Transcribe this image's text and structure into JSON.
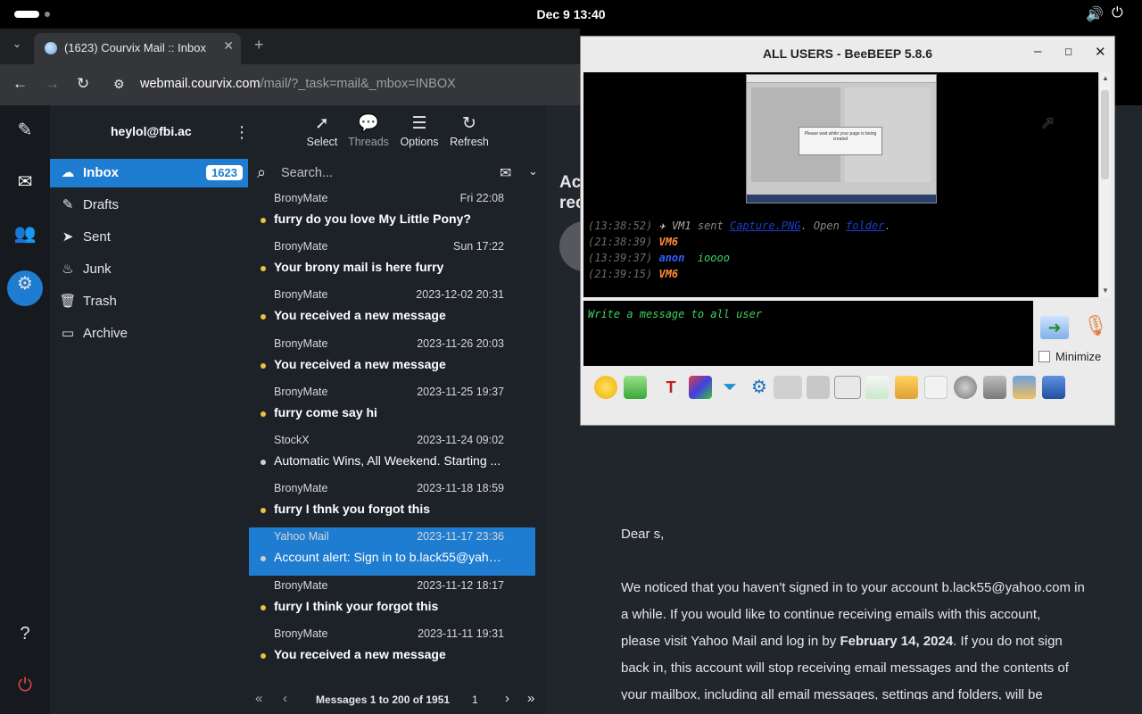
{
  "topbar": {
    "clock": "Dec 9  13:40"
  },
  "browser": {
    "tab_title": "(1623) Courvix Mail :: Inbox",
    "url_domain": "webmail.courvix.com",
    "url_path": "/mail/?_task=mail&_mbox=INBOX"
  },
  "account": "heylol@fbi.ac",
  "toolbar": {
    "select": "Select",
    "threads": "Threads",
    "options": "Options",
    "refresh": "Refresh"
  },
  "search_placeholder": "Search...",
  "folders": [
    {
      "label": "Inbox",
      "icon": "inbox-icon",
      "count": "1623"
    },
    {
      "label": "Drafts",
      "icon": "pencil-icon"
    },
    {
      "label": "Sent",
      "icon": "paper-plane-icon"
    },
    {
      "label": "Junk",
      "icon": "fire-icon"
    },
    {
      "label": "Trash",
      "icon": "trash-icon"
    },
    {
      "label": "Archive",
      "icon": "folder-icon"
    }
  ],
  "messages": [
    {
      "from": "BronyMate",
      "date": "Fri 22:08",
      "subject": "furry do you love My Little Pony?",
      "unread": true
    },
    {
      "from": "BronyMate",
      "date": "Sun 17:22",
      "subject": "Your brony mail is here furry",
      "unread": true
    },
    {
      "from": "BronyMate",
      "date": "2023-12-02 20:31",
      "subject": "You received a new message",
      "unread": true
    },
    {
      "from": "BronyMate",
      "date": "2023-11-26 20:03",
      "subject": "You received a new message",
      "unread": true
    },
    {
      "from": "BronyMate",
      "date": "2023-11-25 19:37",
      "subject": "furry come say hi",
      "unread": true
    },
    {
      "from": "StockX",
      "date": "2023-11-24 09:02",
      "subject": "Automatic Wins, All Weekend. Starting ...",
      "unread": false
    },
    {
      "from": "BronyMate",
      "date": "2023-11-18 18:59",
      "subject": "furry I thnk you forgot this",
      "unread": true
    },
    {
      "from": "Yahoo Mail",
      "date": "2023-11-17 23:36",
      "subject": "Account alert: Sign in to b.lack55@yaho...",
      "unread": false,
      "selected": true
    },
    {
      "from": "BronyMate",
      "date": "2023-11-12 18:17",
      "subject": "furry I think your forgot this",
      "unread": true
    },
    {
      "from": "BronyMate",
      "date": "2023-11-11 19:31",
      "subject": "You received a new message",
      "unread": true
    }
  ],
  "pager": {
    "text": "Messages 1 to 200 of 1951",
    "page": "1"
  },
  "preview": {
    "title_frag": "Ac\nrec",
    "greeting": "Dear s,",
    "body_1": "We noticed that you haven't signed in to your account b.lack55@yahoo.com in",
    "body_2": "a while. If you would like to continue receiving emails with this account,",
    "body_3a": "please visit Yahoo Mail and log in by ",
    "body_3b": "February 14, 2024",
    "body_3c": ". If you do not sign",
    "body_4": "back in, this account will stop receiving email messages and the contents of",
    "body_5": "your mailbox, including all email messages, settings and folders, will be"
  },
  "beebeep": {
    "title": "ALL USERS - BeeBEEP 5.8.6",
    "chat": [
      {
        "time": "(13:38:52)",
        "user": "VM1",
        "text": " sent ",
        "link1": "Capture.PNG",
        "mid": ". Open ",
        "link2": "folder",
        "end": "."
      },
      {
        "time": "(21:38:39)",
        "user": "VM6"
      },
      {
        "time": "(13:39:37)",
        "user": "anon",
        "text": "ioooo"
      },
      {
        "time": "(21:39:15)",
        "user": "VM6"
      }
    ],
    "input_placeholder": "Write a message to all user",
    "minimize_label": "Minimize",
    "shot_caption": "Please wait while your page is being created"
  },
  "colors": {
    "accent": "#1f7dd1",
    "unread_dot": "#f0c040",
    "vm6": "#ff8a3c",
    "anon": "#3060ff",
    "chat_green": "#40d060"
  }
}
